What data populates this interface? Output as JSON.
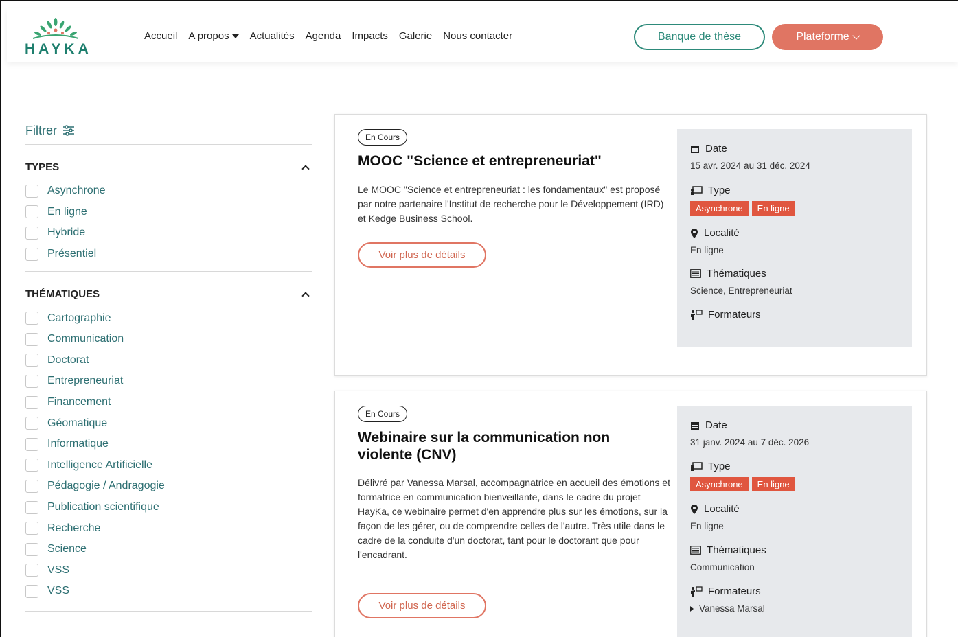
{
  "header": {
    "logo_text": "HAYKA",
    "nav": [
      "Accueil",
      "A propos",
      "Actualités",
      "Agenda",
      "Impacts",
      "Galerie",
      "Nous contacter"
    ],
    "banque_label": "Banque de thèse",
    "plateforme_label": "Plateforme"
  },
  "filters": {
    "title": "Filtrer",
    "types": {
      "heading": "TYPES",
      "options": [
        "Asynchrone",
        "En ligne",
        "Hybride",
        "Présentiel"
      ]
    },
    "thematiques": {
      "heading": "THÉMATIQUES",
      "options": [
        "Cartographie",
        "Communication",
        "Doctorat",
        "Entrepreneuriat",
        "Financement",
        "Géomatique",
        "Informatique",
        "Intelligence Artificielle",
        "Pédagogie / Andragogie",
        "Publication scientifique",
        "Recherche",
        "Science",
        "VSS",
        "VSS"
      ]
    }
  },
  "cards": [
    {
      "badge": "En Cours",
      "title": "MOOC \"Science et entrepreneuriat\"",
      "description": "Le MOOC \"Science et entrepreneuriat : les fondamentaux\" est proposé par notre partenaire l'Institut de recherche pour le Développement (IRD) et Kedge Business School.",
      "details_label": "Voir plus de détails",
      "date_label": "Date",
      "date_value": "15 avr. 2024 au 31 déc. 2024",
      "type_label": "Type",
      "tags": [
        "Asynchrone",
        "En ligne"
      ],
      "localite_label": "Localité",
      "localite_value": "En ligne",
      "thematiques_label": "Thématiques",
      "thematiques_value": "Science, Entrepreneuriat",
      "formateurs_label": "Formateurs"
    },
    {
      "badge": "En Cours",
      "title": "Webinaire sur la communication non violente (CNV)",
      "description": "Délivré par Vanessa Marsal, accompagnatrice en accueil des émotions et formatrice en communication bienveillante, dans le cadre du projet HayKa, ce webinaire permet d'en apprendre plus sur les émotions, sur la façon de les gérer, ou de comprendre celles de l'autre. Très utile dans le cadre de la conduite d'un doctorat, tant pour le doctorant que pour l'encadrant.",
      "details_label": "Voir plus de détails",
      "date_label": "Date",
      "date_value": "31 janv. 2024 au 7 déc. 2026",
      "type_label": "Type",
      "tags": [
        "Asynchrone",
        "En ligne"
      ],
      "localite_label": "Localité",
      "localite_value": "En ligne",
      "thematiques_label": "Thématiques",
      "thematiques_value": "Communication",
      "formateurs_label": "Formateurs",
      "formateur_name": "Vanessa Marsal"
    }
  ],
  "colors": {
    "brand_green": "#2d8a7a",
    "accent_coral": "#e07563",
    "tag_red": "#e0563f",
    "filter_teal": "#2d6f72"
  }
}
